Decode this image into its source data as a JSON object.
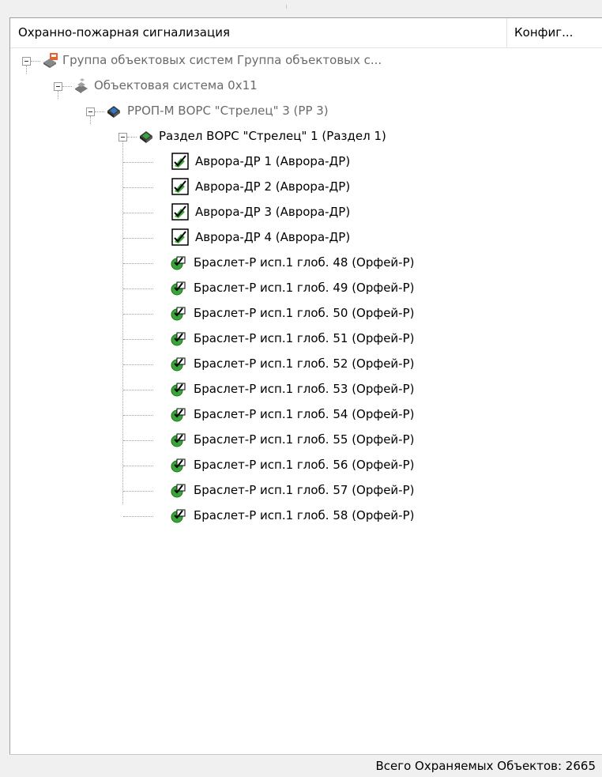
{
  "header": {
    "col1": "Охранно-пожарная сигнализация",
    "col2": "Конфиг..."
  },
  "tree": {
    "group": {
      "label": "Группа объектовых систем Группа объектовых с...",
      "icon": "object-group-icon"
    },
    "system": {
      "label": "Объектовая система 0x11",
      "icon": "object-system-icon"
    },
    "device": {
      "label": "РРОП-М ВОРС \"Стрелец\" 3 (РР 3)",
      "icon": "device-icon"
    },
    "section": {
      "label": "Раздел ВОРС \"Стрелец\" 1 (Раздел 1)",
      "icon": "section-icon"
    },
    "aurora": [
      "Аврора-ДР 1 (Аврора-ДР)",
      "Аврора-ДР 2 (Аврора-ДР)",
      "Аврора-ДР 3 (Аврора-ДР)",
      "Аврора-ДР 4 (Аврора-ДР)"
    ],
    "bracelets": [
      "Браслет-Р исп.1 глоб. 48 (Орфей-Р)",
      "Браслет-Р исп.1 глоб. 49 (Орфей-Р)",
      "Браслет-Р исп.1 глоб. 50 (Орфей-Р)",
      "Браслет-Р исп.1 глоб. 51 (Орфей-Р)",
      "Браслет-Р исп.1 глоб. 52 (Орфей-Р)",
      "Браслет-Р исп.1 глоб. 53 (Орфей-Р)",
      "Браслет-Р исп.1 глоб. 54 (Орфей-Р)",
      "Браслет-Р исп.1 глоб. 55 (Орфей-Р)",
      "Браслет-Р исп.1 глоб. 56 (Орфей-Р)",
      "Браслет-Р исп.1 глоб. 57 (Орфей-Р)",
      "Браслет-Р исп.1 глоб. 58 (Орфей-Р)"
    ]
  },
  "status": {
    "text": "Всего Охраняемых Объектов: 2665"
  },
  "colors": {
    "muted_text": "#6a6a6a",
    "tree_lines": "#a0a0a0",
    "device_green": "#2e8b2e"
  }
}
